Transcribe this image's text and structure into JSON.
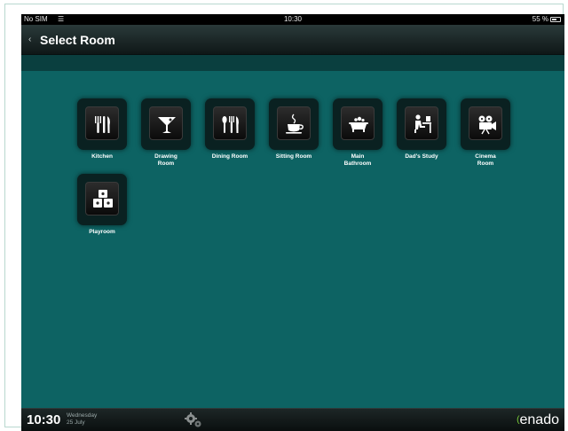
{
  "status_bar": {
    "carrier": "No SIM",
    "wifi_icon": "wifi-icon",
    "clock": "10:30",
    "battery": "55 %"
  },
  "nav": {
    "back_icon": "chevron-left-icon",
    "title": "Select Room"
  },
  "rooms": [
    {
      "label": "Kitchen",
      "icon": "cutlery-icon"
    },
    {
      "label": "Drawing\nRoom",
      "icon": "cocktail-icon"
    },
    {
      "label": "Dining Room",
      "icon": "cutlery-icon"
    },
    {
      "label": "Sitting Room",
      "icon": "coffee-cup-icon"
    },
    {
      "label": "Main\nBathroom",
      "icon": "bathtub-icon"
    },
    {
      "label": "Dad's Study",
      "icon": "desk-person-icon"
    },
    {
      "label": "Cinema\nRoom",
      "icon": "film-camera-icon"
    },
    {
      "label": "Playroom",
      "icon": "toy-blocks-icon"
    }
  ],
  "bottom_bar": {
    "time": "10:30",
    "day": "Wednesday",
    "date": "25 July",
    "settings_icon": "gears-icon",
    "logo": "enado"
  },
  "colors": {
    "background": "#0d6363",
    "accent": "#7ed23a"
  }
}
